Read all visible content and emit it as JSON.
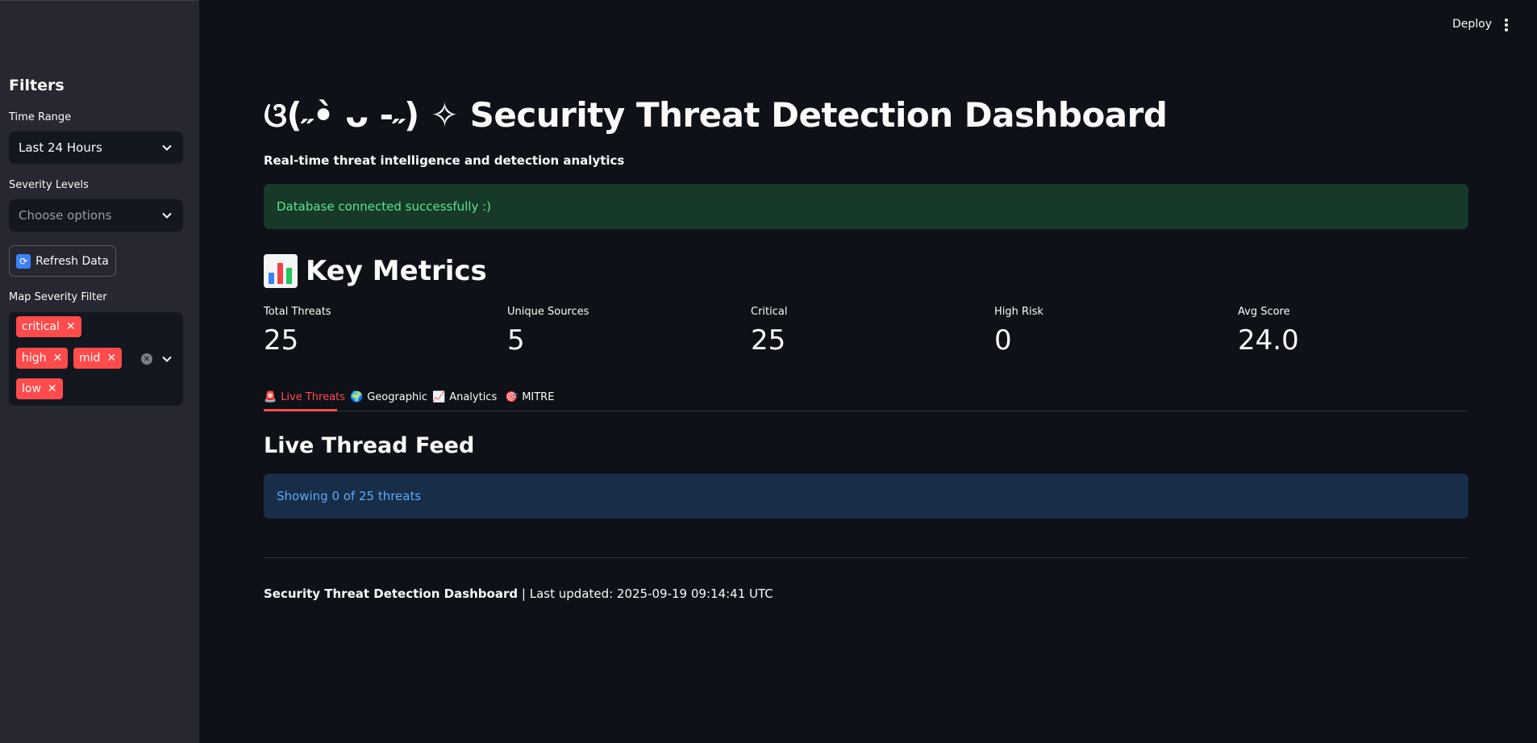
{
  "header": {
    "deploy_label": "Deploy"
  },
  "sidebar": {
    "heading": "Filters",
    "time_range": {
      "label": "Time Range",
      "value": "Last 24 Hours"
    },
    "severity_levels": {
      "label": "Severity Levels",
      "placeholder": "Choose options"
    },
    "refresh_button": "Refresh Data",
    "map_severity_filter": {
      "label": "Map Severity Filter",
      "tags": [
        "critical",
        "high",
        "mid",
        "low"
      ]
    }
  },
  "main": {
    "title": "ଓ(˶•̀ ᴗ -˶) ✧ Security Threat Detection Dashboard",
    "subtitle": "Real-time threat intelligence and detection analytics",
    "success_alert": "Database connected successfully :)",
    "metrics_title": "Key Metrics",
    "metrics": [
      {
        "label": "Total Threats",
        "value": "25"
      },
      {
        "label": "Unique Sources",
        "value": "5"
      },
      {
        "label": "Critical",
        "value": "25"
      },
      {
        "label": "High Risk",
        "value": "0"
      },
      {
        "label": "Avg Score",
        "value": "24.0"
      }
    ],
    "tabs": [
      {
        "icon": "🚨",
        "label": "Live Threats",
        "active": true
      },
      {
        "icon": "🌍",
        "label": "Geographic",
        "active": false
      },
      {
        "icon": "📈",
        "label": "Analytics",
        "active": false
      },
      {
        "icon": "🎯",
        "label": "MITRE",
        "active": false
      }
    ],
    "feed_title": "Live Thread Feed",
    "info_alert": "Showing 0 of 25 threats",
    "footer": {
      "bold": "Security Threat Detection Dashboard",
      "rest": " | Last updated: 2025-09-19 09:14:41 UTC"
    }
  },
  "colors": {
    "accent": "#ff4b4b",
    "success_bg": "#173929",
    "success_text": "#5ce488",
    "info_bg": "#172d48",
    "info_text": "#5eaaf7"
  }
}
